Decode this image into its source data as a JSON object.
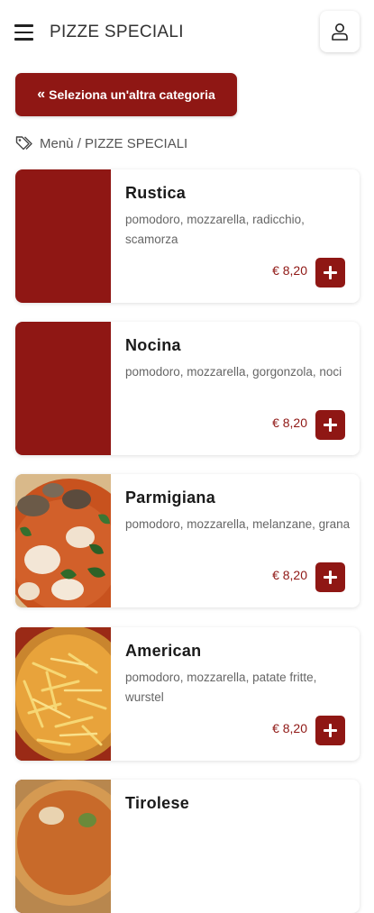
{
  "header": {
    "title": "PIZZE SPECIALI",
    "menu_icon": "hamburger-icon",
    "user_icon": "user-icon"
  },
  "category_button": {
    "icon": "double-chevron-left-icon",
    "label": "Seleziona un'altra categoria"
  },
  "breadcrumb": {
    "icon": "tags-icon",
    "text": "Menù / PIZZE SPECIALI"
  },
  "colors": {
    "accent": "#8f1714"
  },
  "products": [
    {
      "name": "Rustica",
      "description": "pomodoro, mozzarella, radicchio, scamorza",
      "price": "€ 8,20",
      "image": "placeholder"
    },
    {
      "name": "Nocina",
      "description": "pomodoro, mozzarella, gorgonzola, noci",
      "price": "€ 8,20",
      "image": "placeholder"
    },
    {
      "name": "Parmigiana",
      "description": "pomodoro, mozzarella, melanzane, grana",
      "price": "€ 8,20",
      "image": "pizza-parmigiana-photo"
    },
    {
      "name": "American",
      "description": "pomodoro, mozzarella, patate fritte, wurstel",
      "price": "€ 8,20",
      "image": "pizza-american-photo"
    },
    {
      "name": "Tirolese",
      "description": "",
      "price": "",
      "image": "pizza-photo"
    }
  ]
}
